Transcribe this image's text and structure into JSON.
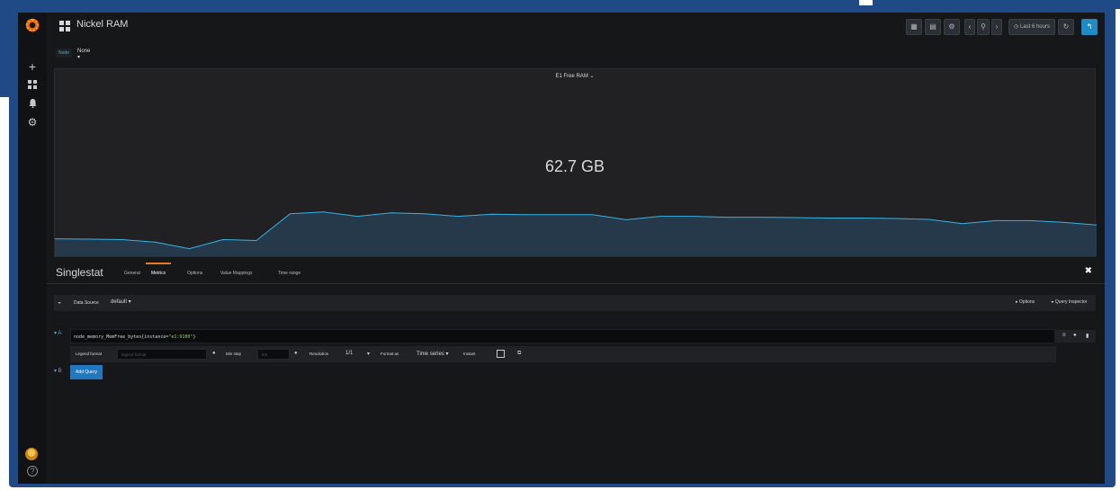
{
  "dashboard": {
    "title": "Nickel RAM"
  },
  "topbar": {
    "time_range": "Last 6 hours",
    "buttons": [
      "add-panel-icon",
      "save-icon",
      "settings-icon",
      "time-back-icon",
      "zoom-out-icon",
      "time-forward-icon",
      "refresh-icon",
      "back-to-dashboard-icon"
    ]
  },
  "variable": {
    "label": "Node",
    "value": "None ▾"
  },
  "panel": {
    "title": "E1 Free RAM ⌄",
    "value": "62.7 GB",
    "sparkline_color": "#33b5e5",
    "spark_points": [
      0.28,
      0.27,
      0.26,
      0.2,
      0.05,
      0.26,
      0.24,
      0.86,
      0.9,
      0.8,
      0.88,
      0.86,
      0.8,
      0.85,
      0.84,
      0.84,
      0.84,
      0.72,
      0.8,
      0.8,
      0.78,
      0.78,
      0.77,
      0.76,
      0.76,
      0.75,
      0.73,
      0.63,
      0.7,
      0.7,
      0.66,
      0.6
    ]
  },
  "editor": {
    "title": "Singlestat",
    "tabs": [
      "General",
      "Metrics",
      "Options",
      "Value Mappings",
      "Time range"
    ],
    "active_tab": "Metrics",
    "close": "✖"
  },
  "datasource": {
    "label": "Data Source",
    "value": "default ▾",
    "options": "▸ Options",
    "inspector": "▸ Query Inspector"
  },
  "query": {
    "letter": "▾ A",
    "expr_prefix": "node_memory_MemFree_bytes{instance=",
    "expr_string": "\"e1:9100\"",
    "expr_suffix": "}"
  },
  "query_options": {
    "legend_label": "Legend format",
    "legend_placeholder": "legend format",
    "minstep_label": "Min step",
    "minstep_placeholder": "5m",
    "resolution_label": "Resolution",
    "resolution_value": "1/1",
    "format_label": "Format as",
    "format_value": "Time series ▾",
    "instant_label": "Instant"
  },
  "add_query": {
    "letter": "▾ B",
    "label": "Add Query"
  }
}
